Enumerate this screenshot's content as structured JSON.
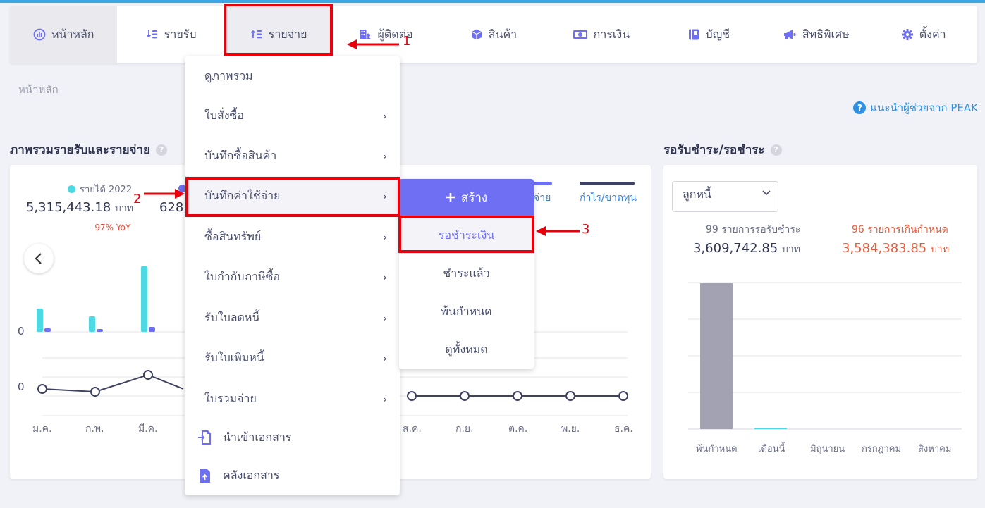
{
  "nav": {
    "items": [
      {
        "label": "หน้าหลัก",
        "icon": "dashboard-icon"
      },
      {
        "label": "รายรับ",
        "icon": "income-icon"
      },
      {
        "label": "รายจ่าย",
        "icon": "expense-icon"
      },
      {
        "label": "ผู้ติดต่อ",
        "icon": "contacts-icon"
      },
      {
        "label": "สินค้า",
        "icon": "box-icon"
      },
      {
        "label": "การเงิน",
        "icon": "money-icon"
      },
      {
        "label": "บัญชี",
        "icon": "book-icon"
      },
      {
        "label": "สิทธิพิเศษ",
        "icon": "megaphone-icon"
      },
      {
        "label": "ตั้งค่า",
        "icon": "gear-icon"
      }
    ]
  },
  "breadcrumb": "หน้าหลัก",
  "help_link": "แนะนำผู้ช่วยจาก PEAK",
  "left_section": {
    "title": "ภาพรวมรายรับและรายจ่าย",
    "legend_income": "รายได้ 2022",
    "income_amount": "5,315,443.18",
    "income_unit": "บาท",
    "yoy": "-97% YoY",
    "second_amount_partial": "628,",
    "legend_expense_partial": "จ่าย",
    "legend_profit": "กำไร/ขาดทุน",
    "zero_top": "0",
    "zero_bottom": "0",
    "months_left": [
      "ม.ค.",
      "ก.พ.",
      "มี.ค."
    ],
    "months_right": [
      "ส.ค.",
      "ก.ย.",
      "ต.ค.",
      "พ.ย.",
      "ธ.ค."
    ]
  },
  "right_section": {
    "title": "รอรับชำระ/รอชำระ",
    "select_value": "ลูกหนี้",
    "label_pending": "99 รายการรอรับชำระ",
    "amount_pending": "3,609,742.85",
    "label_overdue": "96 รายการเกินกำหนด",
    "amount_overdue": "3,584,383.85",
    "unit": "บาท",
    "categories": [
      "พ้นกำหนด",
      "เดือนนี้",
      "มิถุนายน",
      "กรกฎาคม",
      "สิงหาคม"
    ]
  },
  "dropdown": {
    "items": [
      {
        "label": "ดูภาพรวม",
        "chevron": false
      },
      {
        "label": "ใบสั่งซื้อ",
        "chevron": true
      },
      {
        "label": "บันทึกซื้อสินค้า",
        "chevron": true
      },
      {
        "label": "บันทึกค่าใช้จ่าย",
        "chevron": true
      },
      {
        "label": "ซื้อสินทรัพย์",
        "chevron": true
      },
      {
        "label": "ใบกำกับภาษีซื้อ",
        "chevron": true
      },
      {
        "label": "รับใบลดหนี้",
        "chevron": true
      },
      {
        "label": "รับใบเพิ่มหนี้",
        "chevron": true
      },
      {
        "label": "ใบรวมจ่าย",
        "chevron": true
      },
      {
        "label": "นำเข้าเอกสาร",
        "icon": "import-icon"
      },
      {
        "label": "คลังเอกสาร",
        "icon": "file-upload-icon"
      }
    ],
    "chevron_glyph": "›"
  },
  "submenu": {
    "create_label": "สร้าง",
    "items": [
      "รอชำระเงิน",
      "ชำระแล้ว",
      "พ้นกำหนด",
      "ดูทั้งหมด"
    ]
  },
  "annotations": [
    "1",
    "2",
    "3"
  ],
  "colors": {
    "accent": "#6e6ff2",
    "income": "#4dd9e3",
    "profit_line": "#3e4160",
    "annotation": "#e8000b"
  }
}
